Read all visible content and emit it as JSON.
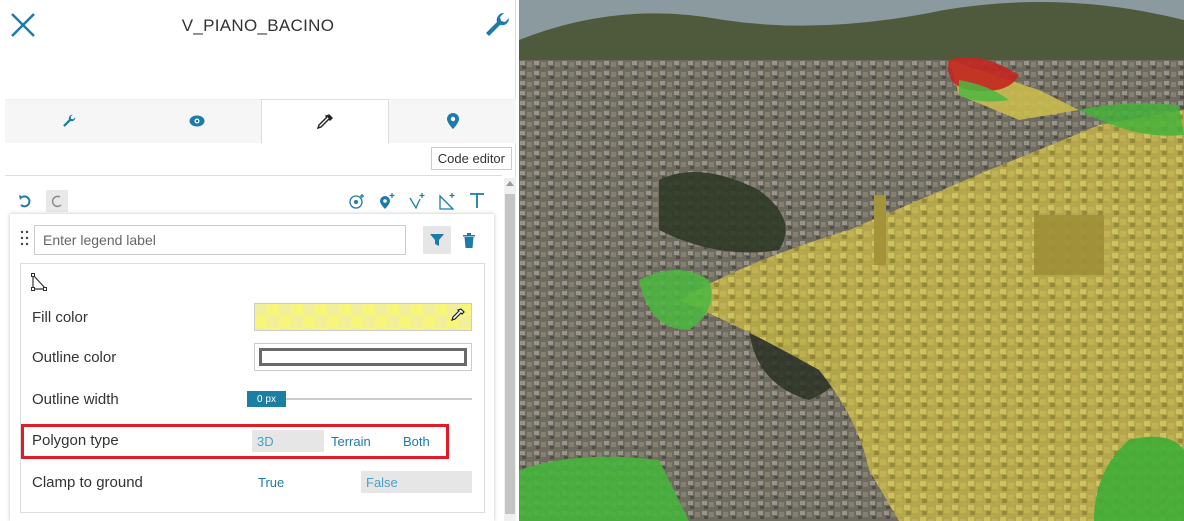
{
  "header": {
    "title": "V_PIANO_BACINO"
  },
  "tabs": [
    {
      "name": "settings",
      "icon": "wrench-icon",
      "active": false
    },
    {
      "name": "visibility",
      "icon": "eye-icon",
      "active": false
    },
    {
      "name": "style",
      "icon": "eyedropper-icon",
      "active": true
    },
    {
      "name": "location",
      "icon": "map-pin-icon",
      "active": false
    }
  ],
  "code_editor_label": "Code editor",
  "toolbar": {
    "left": [
      "undo-icon",
      "redo-icon"
    ],
    "right": [
      "add-point-icon",
      "add-pin-icon",
      "add-line-icon",
      "add-polygon-icon",
      "add-text-icon"
    ]
  },
  "legend": {
    "placeholder": "Enter legend label",
    "fill_color_label": "Fill color",
    "outline_color_label": "Outline color",
    "outline_width_label": "Outline width",
    "outline_width_value": "0 px",
    "polygon_type_label": "Polygon type",
    "polygon_type_options": [
      "3D",
      "Terrain",
      "Both"
    ],
    "polygon_type_selected": "3D",
    "clamp_label": "Clamp to ground",
    "clamp_options": [
      "True",
      "False"
    ],
    "clamp_selected": "False"
  },
  "colors": {
    "accent": "#1a7fa3",
    "highlight": "#e11c26",
    "fill": "#f7f57a"
  }
}
